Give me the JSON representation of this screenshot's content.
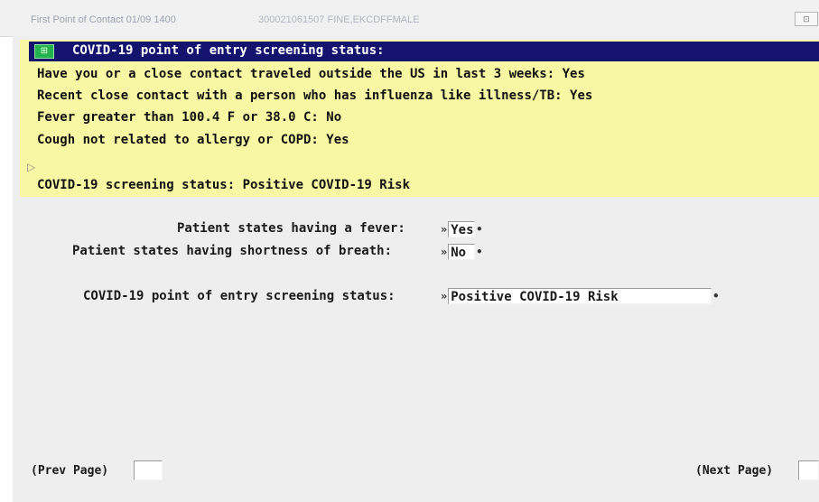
{
  "window": {
    "title_left": "First Point of Contact  01/09 1400",
    "title_right": "300021061507  FINE,EKCDFFMALE",
    "close_glyph": "⊡"
  },
  "banner": {
    "icon_glyph": "⊞",
    "header": "COVID-19 point of entry screening status:",
    "lines": [
      "Have you or a close contact traveled outside the US in last 3 weeks: Yes",
      "Recent close contact with a person who has influenza like illness/TB: Yes",
      "Fever greater than 100.4 F or 38.0 C: No",
      "Cough not related to allergy or COPD: Yes"
    ],
    "status_line": "COVID-19 screening status: Positive COVID-19 Risk",
    "colors": {
      "header_bg": "#14146e",
      "banner_bg": "#f8f8a4",
      "icon_bg": "#22b14c"
    }
  },
  "form": {
    "fever": {
      "label": "Patient states having a fever:",
      "value": "Yes"
    },
    "breath": {
      "label": "Patient states having shortness of breath:",
      "value": "No"
    },
    "status": {
      "label": "COVID-19 point of entry screening status:",
      "value": "Positive COVID-19 Risk"
    },
    "open_mark": "»",
    "close_mark": "•"
  },
  "nav": {
    "prev_label": "(Prev Page)",
    "next_label": "(Next Page)"
  }
}
